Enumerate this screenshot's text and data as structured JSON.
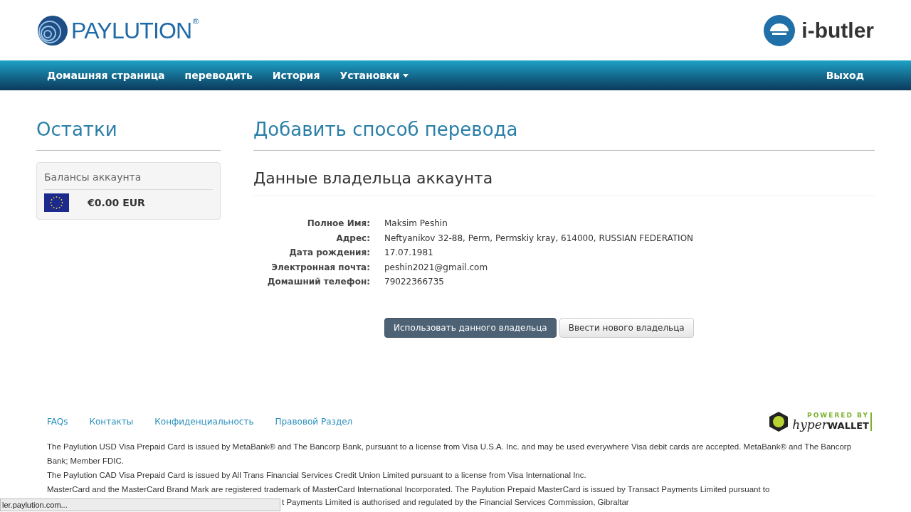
{
  "header": {
    "logo_text": "PAYLUTION",
    "logo_mark": "®",
    "partner_logo_text": "i-butler"
  },
  "nav": {
    "items": [
      {
        "label": "Домашняя страница",
        "dropdown": false
      },
      {
        "label": "переводить",
        "dropdown": false
      },
      {
        "label": "История",
        "dropdown": false
      },
      {
        "label": "Установки",
        "dropdown": true
      }
    ],
    "logout": "Выход"
  },
  "sidebar": {
    "title": "Остатки",
    "panel_title": "Балансы аккаунта",
    "balances": [
      {
        "amount": "€0.00 EUR"
      }
    ]
  },
  "main": {
    "title": "Добавить способ перевода",
    "section_title": "Данные владельца аккаунта",
    "fields": [
      {
        "label": "Полное Имя:",
        "value": "Maksim Peshin"
      },
      {
        "label": "Адрес:",
        "value": "Neftyanikov 32-88, Perm, Permskiy kray, 614000, RUSSIAN FEDERATION"
      },
      {
        "label": "Дата рождения:",
        "value": "17.07.1981"
      },
      {
        "label": "Электронная почта:",
        "value": "peshin2021@gmail.com"
      },
      {
        "label": "Домашний телефон:",
        "value": "79022366735"
      }
    ],
    "buttons": [
      {
        "label": "Использовать данного владельца",
        "kind": "primary"
      },
      {
        "label": "Ввести нового владельца",
        "kind": "default"
      }
    ]
  },
  "footer": {
    "links": [
      "FAQs",
      "Контакты",
      "Конфиденциальность",
      "Правовой Раздел"
    ],
    "powered_by": {
      "top": "POWERED BY",
      "hyper": "hyper",
      "wallet": "WALLET"
    },
    "paragraphs": [
      "The Paylution USD Visa Prepaid Card is issued by MetaBank® and The Bancorp Bank, pursuant to a license from Visa U.S.A. Inc. and may be used everywhere Visa debit cards are accepted. MetaBank® and The Bancorp Bank; Member FDIC.",
      "The Paylution CAD Visa Prepaid Card is issued by All Trans Financial Services Credit Union Limited pursuant to a license from Visa International Inc.",
      "MasterCard and the MasterCard Brand Mark are registered trademark of MasterCard International Incorporated. The Paylution Prepaid MasterCard is issued by Transact Payments Limited pursuant to"
    ],
    "partial_line": "t Payments Limited is authorised and regulated by the Financial Services Commission, Gibraltar"
  },
  "status_bar": {
    "url": "ler.paylution.com..."
  }
}
